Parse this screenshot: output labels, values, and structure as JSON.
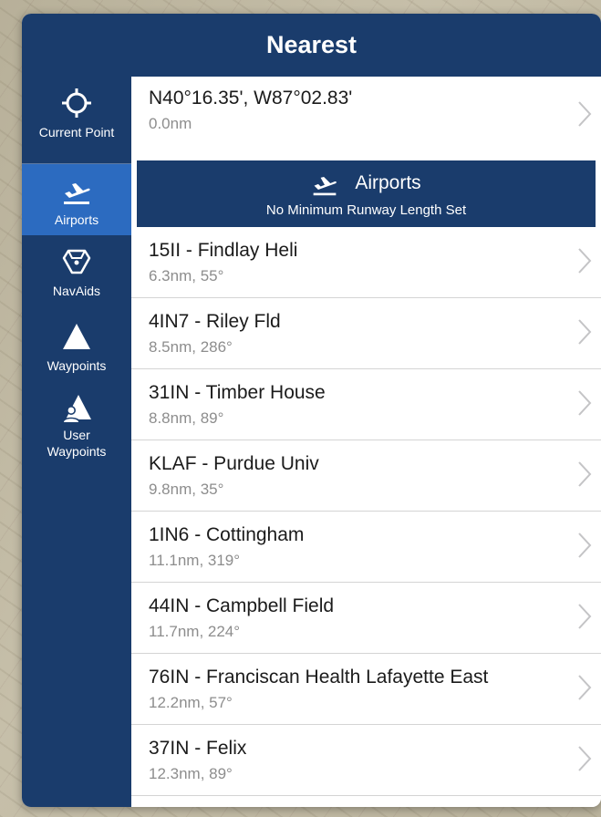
{
  "header": {
    "title": "Nearest"
  },
  "sidebar": {
    "items": [
      {
        "label": "Current Point",
        "icon": "crosshair-icon",
        "selected": false
      },
      {
        "label": "Airports",
        "icon": "airplane-takeoff-icon",
        "selected": true
      },
      {
        "label": "NavAids",
        "icon": "vor-icon",
        "selected": false
      },
      {
        "label": "Waypoints",
        "icon": "triangle-icon",
        "selected": false
      },
      {
        "label": "User\nWaypoints",
        "label_line1": "User",
        "label_line2": "Waypoints",
        "icon": "user-waypoint-icon",
        "selected": false
      }
    ]
  },
  "current_point": {
    "coordinates": "N40°16.35', W87°02.83'",
    "distance": "0.0nm"
  },
  "section": {
    "title": "Airports",
    "subtitle": "No Minimum Runway Length Set"
  },
  "airports": [
    {
      "name": "15II - Findlay Heli",
      "detail": "6.3nm, 55°"
    },
    {
      "name": "4IN7 - Riley Fld",
      "detail": "8.5nm, 286°"
    },
    {
      "name": "31IN - Timber House",
      "detail": "8.8nm, 89°"
    },
    {
      "name": "KLAF - Purdue Univ",
      "detail": "9.8nm, 35°"
    },
    {
      "name": "1IN6 - Cottingham",
      "detail": "11.1nm, 319°"
    },
    {
      "name": "44IN - Campbell Field",
      "detail": "11.7nm, 224°"
    },
    {
      "name": "76IN - Franciscan Health Lafayette East",
      "detail": "12.2nm, 57°"
    },
    {
      "name": "37IN - Felix",
      "detail": "12.3nm, 89°"
    }
  ],
  "colors": {
    "nav_blue": "#1a3c6c",
    "selected_blue": "#2c6bc0",
    "secondary_text": "#8d8d8d"
  }
}
